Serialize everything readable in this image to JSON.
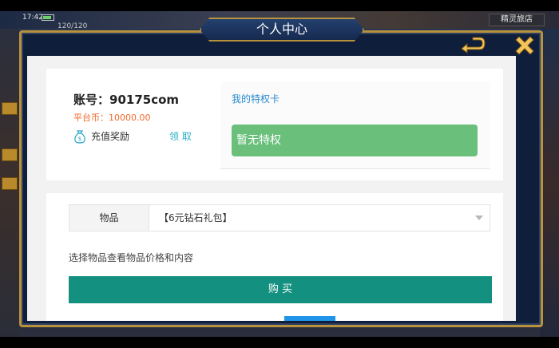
{
  "status": {
    "time": "17:42",
    "energy": "120/120",
    "store_label": "精灵旅店"
  },
  "modal": {
    "title": "个人中心"
  },
  "account": {
    "label": "账号：",
    "id": "90175com",
    "currency_label": "平台币：",
    "currency_value": "10000.00",
    "recharge_label": "充值奖励",
    "claim_label": "领 取"
  },
  "privilege": {
    "title": "我的特权卡",
    "status": "暂无特权"
  },
  "purchase": {
    "item_label": "物品",
    "selected_item": "【6元钻石礼包】",
    "hint": "选择物品查看物品价格和内容",
    "buy_label": "购 买"
  },
  "colors": {
    "accent_green": "#6ac07b",
    "buy_teal": "#139080",
    "currency_orange": "#ee6a2a",
    "link_blue": "#2b8bd1",
    "frame_gold": "#b8923c"
  }
}
